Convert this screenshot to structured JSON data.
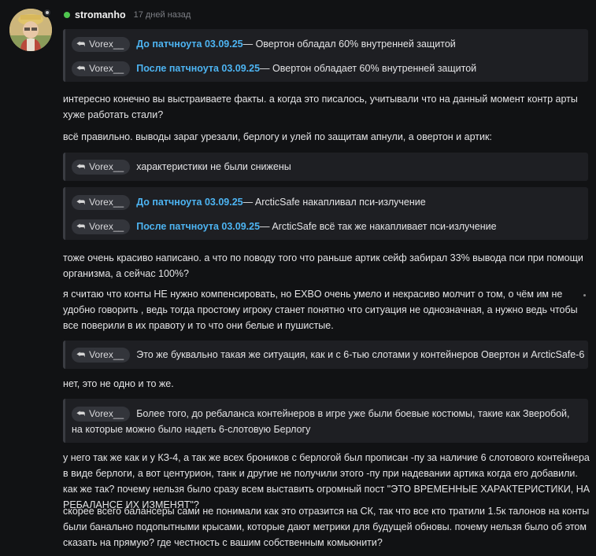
{
  "author": {
    "name": "stromanho",
    "time": "17 дней назад"
  },
  "mention_name": "Vorex__",
  "q1": {
    "line1": {
      "link": "До патчноута 03.09.25",
      "text": " — Овертон обладал 60% внутренней защитой"
    },
    "line2": {
      "link": "После патчноута 03.09.25",
      "text": " — Овертон обладает 60% внутренней защитой"
    }
  },
  "p1": "интересно конечно вы выстраиваете факты. а когда это писалось, учитывали что на данный момент контр арты хуже работать стали?",
  "p2": "всё правильно. выводы зараг урезали, берлогу и улей по защитам апнули, а овертон и артик:",
  "q2": {
    "text": "характеристики не были снижены"
  },
  "q3": {
    "line1": {
      "link": "До патчноута 03.09.25",
      "text": " — ArcticSafe накапливал пси-излучение"
    },
    "line2": {
      "link": "После патчноута 03.09.25",
      "text": " — ArcticSafe всё так же накапливает пси-излучение"
    }
  },
  "p3": "тоже очень красиво написано. а что по поводу того что раньше артик сейф забирал 33% вывода пси при помощи организма, а сейчас 100%?",
  "p4": "я считаю что конты НЕ нужно компенсировать, но EXBO очень умело и некрасиво молчит о том, о чём им не удобно говорить , ведь тогда простому игроку станет понятно что ситуация не однозначная, а нужно ведь чтобы все поверили в их правоту и то что они белые и пушистые.",
  "q4": {
    "text": "Это же буквально такая же ситуация, как и с 6-тью слотами у контейнеров Овертон и ArcticSafe-6"
  },
  "p5": "нет, это не одно и то же.",
  "q5": {
    "text": "Более того, до ребаланса контейнеров в игре уже были боевые костюмы, такие как Зверобой, на которые можно было надеть 6-слотовую Берлогу"
  },
  "p6": "у него так же как и у КЗ-4, а так же всех броников с берлогой был прописан -пу за наличие 6 слотового контейнера в виде берлоги, а вот центурион, танк и другие не получили этого -пу при надевании артика когда его добавили. как же так? почему нельзя было сразу всем выставить огромный пост \"ЭТО ВРЕМЕННЫЕ ХАРАКТЕРИСТИКИ, НА РЕБАЛАНСЕ ИХ ИЗМЕНЯТ\"?",
  "p7": "скорее всего балансеры сами не понимали как это отразится на СК, так что все кто тратили 1.5к талонов на конты были банально подопытными крысами, которые дают метрики для будущей обновы. почему нельзя было об этом сказать на прямую? где честность с вашим собственным комьюнити?"
}
